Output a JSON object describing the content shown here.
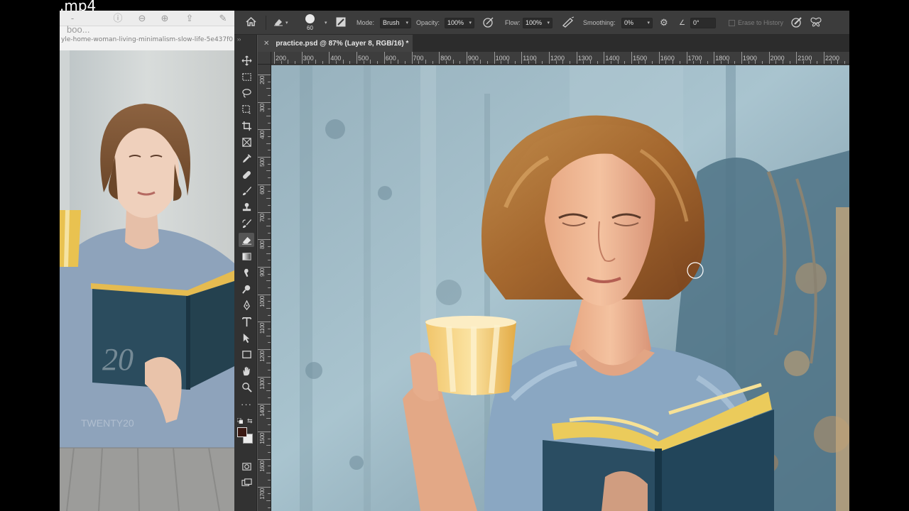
{
  "clip": {
    "name_fragment": ".mp4"
  },
  "reference": {
    "title_fragment": "-boo...",
    "url_fragment": "yle-home-woman-living-minimalism-slow-life-5e437f0",
    "watermark_number": "20",
    "watermark_text": "TWENTY20"
  },
  "options": {
    "brush_size": "60",
    "mode_label": "Mode:",
    "mode_value": "Brush",
    "opacity_label": "Opacity:",
    "opacity_value": "100%",
    "flow_label": "Flow:",
    "flow_value": "100%",
    "smoothing_label": "Smoothing:",
    "smoothing_value": "0%",
    "angle_value": "0°",
    "erase_to_history_label": "Erase to History"
  },
  "document": {
    "tab_title": "practice.psd @ 87% (Layer 8, RGB/16) *"
  },
  "rulers": {
    "horizontal_labels": [
      "200",
      "300",
      "400",
      "500",
      "600",
      "700",
      "800",
      "900",
      "1000",
      "1100",
      "1200",
      "1300",
      "1400",
      "1500",
      "1600",
      "1700",
      "1800",
      "1900",
      "2000",
      "2100",
      "2200"
    ],
    "vertical_labels": [
      "200",
      "300",
      "400",
      "500",
      "600",
      "700",
      "800",
      "900",
      "1000",
      "1100",
      "1200",
      "1300",
      "1400",
      "1500",
      "1600",
      "1700"
    ]
  },
  "colors": {
    "foreground": "#3a1812",
    "background": "#ececec",
    "ps_panel": "#323232",
    "options_bar": "#3c3c3c"
  },
  "active_tool": "eraser"
}
